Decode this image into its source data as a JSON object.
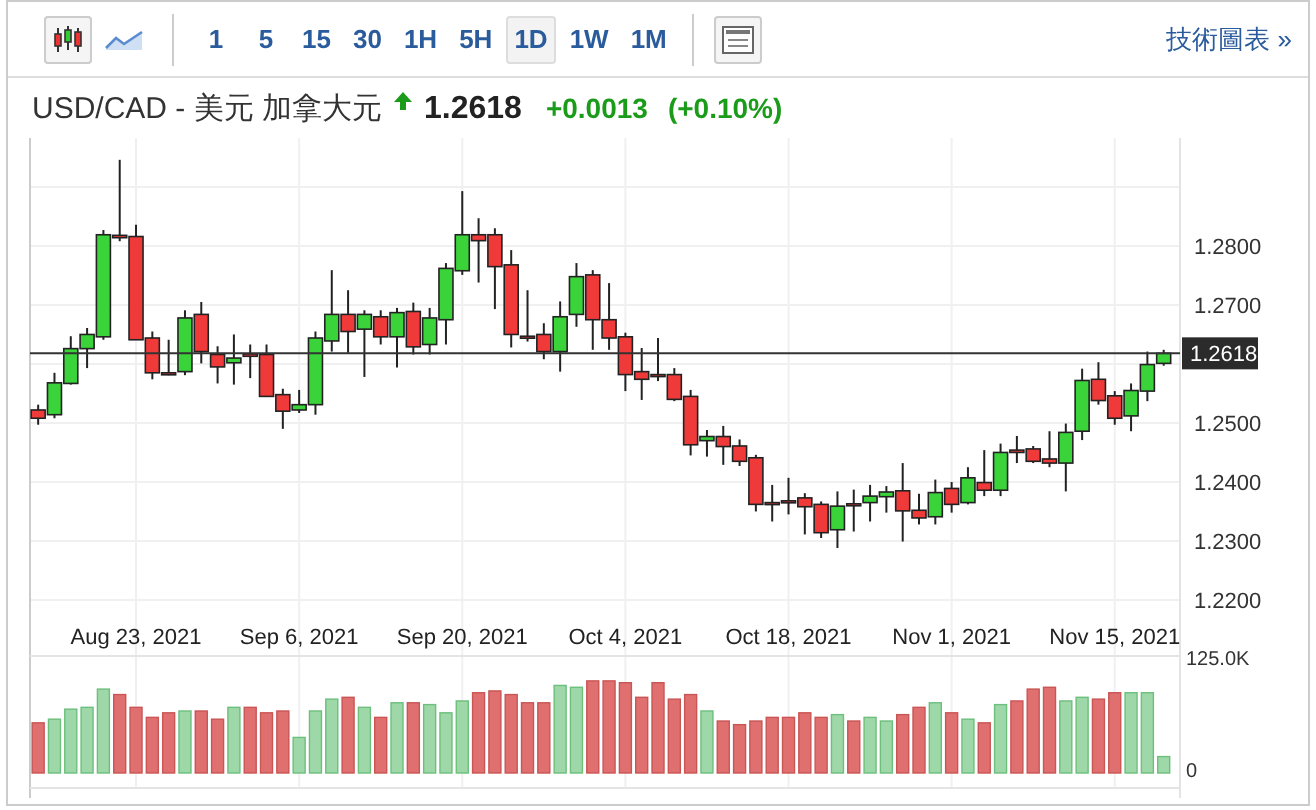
{
  "toolbar": {
    "chart_types": [
      {
        "kind": "candlestick",
        "selected": true
      },
      {
        "kind": "line",
        "selected": false
      }
    ],
    "intervals": [
      {
        "label": "1",
        "selected": false
      },
      {
        "label": "5",
        "selected": false
      },
      {
        "label": "15",
        "selected": false
      },
      {
        "label": "30",
        "selected": false
      },
      {
        "label": "1H",
        "selected": false
      },
      {
        "label": "5H",
        "selected": false
      },
      {
        "label": "1D",
        "selected": true
      },
      {
        "label": "1W",
        "selected": false
      },
      {
        "label": "1M",
        "selected": false
      }
    ],
    "link": "技術圖表 »"
  },
  "quote": {
    "pair": "USD/CAD - 美元 加拿大元",
    "up": true,
    "price": "1.2618",
    "change": "+0.0013",
    "change_percent": "(+0.10%)"
  },
  "chart": {
    "current_price": "1.2618",
    "chart_data": {
      "type": "candlestick",
      "categories": [
        null,
        null,
        null,
        null,
        null,
        null,
        "Aug 23, 2021",
        null,
        null,
        null,
        null,
        null,
        null,
        null,
        null,
        null,
        "Sep 6, 2021",
        null,
        null,
        null,
        null,
        null,
        null,
        null,
        null,
        null,
        "Sep 20, 2021",
        null,
        null,
        null,
        null,
        null,
        null,
        null,
        null,
        null,
        "Oct 4, 2021",
        null,
        null,
        null,
        null,
        null,
        null,
        null,
        null,
        null,
        "Oct 18, 2021",
        null,
        null,
        null,
        null,
        null,
        null,
        null,
        null,
        null,
        "Nov 1, 2021",
        null,
        null,
        null,
        null,
        null,
        null,
        null,
        null,
        null,
        "Nov 15, 2021",
        null,
        null,
        null
      ],
      "ohlc": [
        [
          1.2522,
          1.2531,
          1.2497,
          1.2508
        ],
        [
          1.2514,
          1.2585,
          1.2508,
          1.2568
        ],
        [
          1.2567,
          1.2647,
          1.2565,
          1.2626
        ],
        [
          1.2626,
          1.2661,
          1.2593,
          1.265
        ],
        [
          1.2646,
          1.2827,
          1.2641,
          1.2819
        ],
        [
          1.2818,
          1.2946,
          1.2808,
          1.2814
        ],
        [
          1.2816,
          1.2836,
          1.2641,
          1.2641
        ],
        [
          1.2644,
          1.2655,
          1.2574,
          1.2585
        ],
        [
          1.2585,
          1.2641,
          1.2581,
          1.2583
        ],
        [
          1.2587,
          1.2691,
          1.2581,
          1.2678
        ],
        [
          1.2684,
          1.2705,
          1.2601,
          1.2621
        ],
        [
          1.2616,
          1.263,
          1.2567,
          1.2595
        ],
        [
          1.2602,
          1.265,
          1.2565,
          1.261
        ],
        [
          1.2617,
          1.2633,
          1.2576,
          1.2613
        ],
        [
          1.2616,
          1.2633,
          1.2545,
          1.2545
        ],
        [
          1.2548,
          1.2558,
          1.249,
          1.252
        ],
        [
          1.2522,
          1.2556,
          1.2517,
          1.2531
        ],
        [
          1.2531,
          1.2655,
          1.2514,
          1.2644
        ],
        [
          1.2639,
          1.2759,
          1.2621,
          1.2684
        ],
        [
          1.2684,
          1.2725,
          1.2619,
          1.2655
        ],
        [
          1.2659,
          1.2691,
          1.2578,
          1.2684
        ],
        [
          1.268,
          1.2691,
          1.2633,
          1.2646
        ],
        [
          1.2646,
          1.2695,
          1.2594,
          1.2687
        ],
        [
          1.2689,
          1.2704,
          1.2616,
          1.2629
        ],
        [
          1.2633,
          1.2695,
          1.2616,
          1.2678
        ],
        [
          1.2675,
          1.2771,
          1.2633,
          1.2762
        ],
        [
          1.2758,
          1.2893,
          1.2751,
          1.2819
        ],
        [
          1.2819,
          1.2847,
          1.2738,
          1.2809
        ],
        [
          1.2819,
          1.283,
          1.2693,
          1.2765
        ],
        [
          1.2768,
          1.2793,
          1.2628,
          1.265
        ],
        [
          1.2647,
          1.2725,
          1.2638,
          1.2645
        ],
        [
          1.265,
          1.2669,
          1.2608,
          1.2621
        ],
        [
          1.2621,
          1.2706,
          1.2587,
          1.268
        ],
        [
          1.2684,
          1.2771,
          1.2663,
          1.2748
        ],
        [
          1.2751,
          1.2759,
          1.2624,
          1.2675
        ],
        [
          1.2675,
          1.2737,
          1.2624,
          1.2644
        ],
        [
          1.2646,
          1.2653,
          1.2554,
          1.2582
        ],
        [
          1.2587,
          1.2627,
          1.2539,
          1.2574
        ],
        [
          1.2582,
          1.2644,
          1.2571,
          1.258
        ],
        [
          1.2582,
          1.2593,
          1.2537,
          1.254
        ],
        [
          1.2545,
          1.2556,
          1.2445,
          1.2463
        ],
        [
          1.247,
          1.2488,
          1.2443,
          1.2477
        ],
        [
          1.2477,
          1.2495,
          1.2429,
          1.246
        ],
        [
          1.2461,
          1.2472,
          1.2427,
          1.2435
        ],
        [
          1.2441,
          1.2446,
          1.235,
          1.2362
        ],
        [
          1.2365,
          1.2395,
          1.2333,
          1.2363
        ],
        [
          1.2368,
          1.2407,
          1.2345,
          1.2366
        ],
        [
          1.2373,
          1.2381,
          1.2311,
          1.2358
        ],
        [
          1.2362,
          1.2367,
          1.2305,
          1.2314
        ],
        [
          1.2319,
          1.2384,
          1.2288,
          1.2359
        ],
        [
          1.2363,
          1.2387,
          1.2316,
          1.236
        ],
        [
          1.2365,
          1.2395,
          1.2333,
          1.2376
        ],
        [
          1.2375,
          1.2393,
          1.2348,
          1.2383
        ],
        [
          1.2385,
          1.2432,
          1.2299,
          1.2351
        ],
        [
          1.2352,
          1.238,
          1.2328,
          1.2339
        ],
        [
          1.2341,
          1.2404,
          1.2328,
          1.2382
        ],
        [
          1.2389,
          1.24,
          1.2348,
          1.2362
        ],
        [
          1.2365,
          1.2425,
          1.2362,
          1.2407
        ],
        [
          1.2399,
          1.2454,
          1.2376,
          1.2386
        ],
        [
          1.2386,
          1.2465,
          1.2376,
          1.245
        ],
        [
          1.2454,
          1.2478,
          1.2432,
          1.245
        ],
        [
          1.2456,
          1.2461,
          1.2432,
          1.2435
        ],
        [
          1.2439,
          1.2486,
          1.2425,
          1.2432
        ],
        [
          1.2432,
          1.2499,
          1.2384,
          1.2484
        ],
        [
          1.2486,
          1.2592,
          1.2471,
          1.2572
        ],
        [
          1.2574,
          1.2603,
          1.2531,
          1.2538
        ],
        [
          1.2546,
          1.2554,
          1.2497,
          1.2508
        ],
        [
          1.2512,
          1.2567,
          1.2486,
          1.2555
        ],
        [
          1.2554,
          1.2621,
          1.2537,
          1.2599
        ],
        [
          1.2601,
          1.2624,
          1.2597,
          1.2618
        ]
      ],
      "ylim": [
        1.2105,
        1.2983
      ],
      "yticks": [
        {
          "value": 1.28,
          "label": "1.2800"
        },
        {
          "value": 1.27,
          "label": "1.2700"
        },
        {
          "value": 1.25,
          "label": "1.2500"
        },
        {
          "value": 1.24,
          "label": "1.2400"
        },
        {
          "value": 1.23,
          "label": "1.2300"
        },
        {
          "value": 1.22,
          "label": "1.2200"
        }
      ]
    },
    "volume": {
      "chart_data": {
        "type": "bar",
        "ylim": [
          0,
          125
        ],
        "categories": [
          null,
          null,
          null,
          null,
          null,
          null,
          null,
          null,
          null,
          null,
          null,
          null,
          null,
          null,
          null,
          null,
          null,
          null,
          null,
          null,
          null,
          null,
          null,
          null,
          null,
          null,
          null,
          null,
          null,
          null,
          null,
          null,
          null,
          null,
          null,
          null,
          null,
          null,
          null,
          null,
          null,
          null,
          null,
          null,
          null,
          null,
          null,
          null,
          null,
          null,
          null,
          null,
          null,
          null,
          null,
          null,
          null,
          null,
          null,
          null,
          null,
          null,
          null,
          null,
          null,
          null,
          null,
          null,
          null,
          null
        ],
        "yticks": [
          {
            "value": 125,
            "label": "125.0K"
          },
          {
            "value": 0,
            "label": "0"
          }
        ],
        "values": [
          55,
          59,
          70,
          72,
          92,
          86,
          72,
          61,
          66,
          68,
          68,
          59,
          72,
          72,
          66,
          68,
          39,
          68,
          81,
          83,
          72,
          61,
          77,
          77,
          75,
          66,
          79,
          88,
          90,
          86,
          77,
          77,
          96,
          94,
          101,
          101,
          99,
          83,
          99,
          81,
          86,
          68,
          57,
          53,
          57,
          61,
          61,
          66,
          61,
          64,
          57,
          61,
          57,
          64,
          72,
          77,
          66,
          59,
          55,
          75,
          79,
          92,
          94,
          79,
          83,
          81,
          88,
          88,
          88,
          18
        ]
      }
    }
  }
}
